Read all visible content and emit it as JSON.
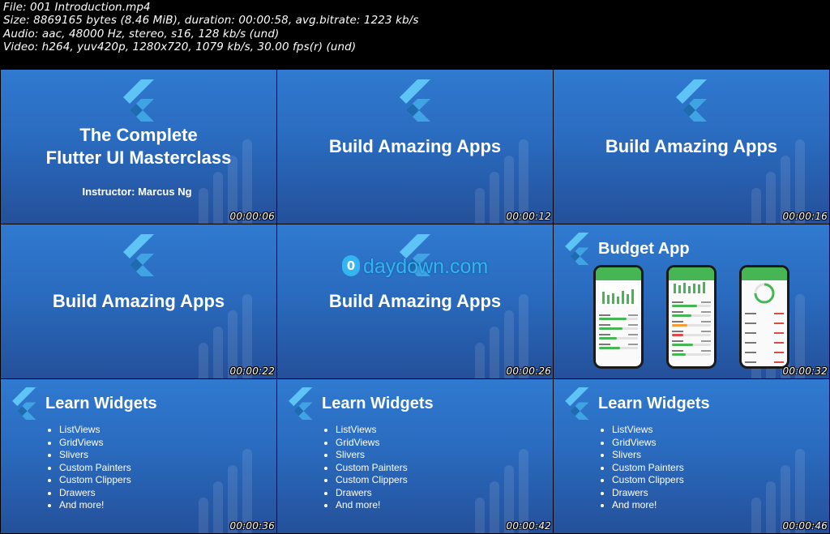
{
  "header": {
    "lines": [
      "File: 001 Introduction.mp4",
      "Size: 8869165 bytes (8.46 MiB), duration: 00:00:58, avg.bitrate: 1223 kb/s",
      "Audio: aac, 48000 Hz, stereo, s16, 128 kb/s (und)",
      "Video: h264, yuv420p, 1280x720, 1079 kb/s, 30.00 fps(r) (und)"
    ]
  },
  "colors": {
    "background": "#000000",
    "slide_top": "#2f7ad0",
    "slide_bottom": "#24509a",
    "flutter_logo": "#5ec3f5",
    "app_green": "#46b553"
  },
  "thumbs": [
    {
      "type": "title",
      "title_line1": "The Complete",
      "title_line2": "Flutter UI Masterclass",
      "subtitle": "Instructor: Marcus Ng",
      "timestamp": "00:00:06"
    },
    {
      "type": "build",
      "title": "Build Amazing Apps",
      "timestamp": "00:00:12"
    },
    {
      "type": "build",
      "title": "Build Amazing Apps",
      "timestamp": "00:00:16"
    },
    {
      "type": "build",
      "title": "Build Amazing Apps",
      "timestamp": "00:00:22"
    },
    {
      "type": "build",
      "title": "Build Amazing Apps",
      "watermark": "daydown.com",
      "watermark_icon": "0",
      "timestamp": "00:00:26"
    },
    {
      "type": "budget",
      "title": "Budget App",
      "timestamp": "00:00:32"
    },
    {
      "type": "widgets",
      "title": "Learn Widgets",
      "items": [
        "ListViews",
        "GridViews",
        "Slivers",
        "Custom Painters",
        "Custom Clippers",
        "Drawers",
        "And more!"
      ],
      "timestamp": "00:00:36"
    },
    {
      "type": "widgets",
      "title": "Learn Widgets",
      "items": [
        "ListViews",
        "GridViews",
        "Slivers",
        "Custom Painters",
        "Custom Clippers",
        "Drawers",
        "And more!"
      ],
      "timestamp": "00:00:42"
    },
    {
      "type": "widgets",
      "title": "Learn Widgets",
      "items": [
        "ListViews",
        "GridViews",
        "Slivers",
        "Custom Painters",
        "Custom Clippers",
        "Drawers",
        "And more!"
      ],
      "timestamp": "00:00:46"
    }
  ]
}
